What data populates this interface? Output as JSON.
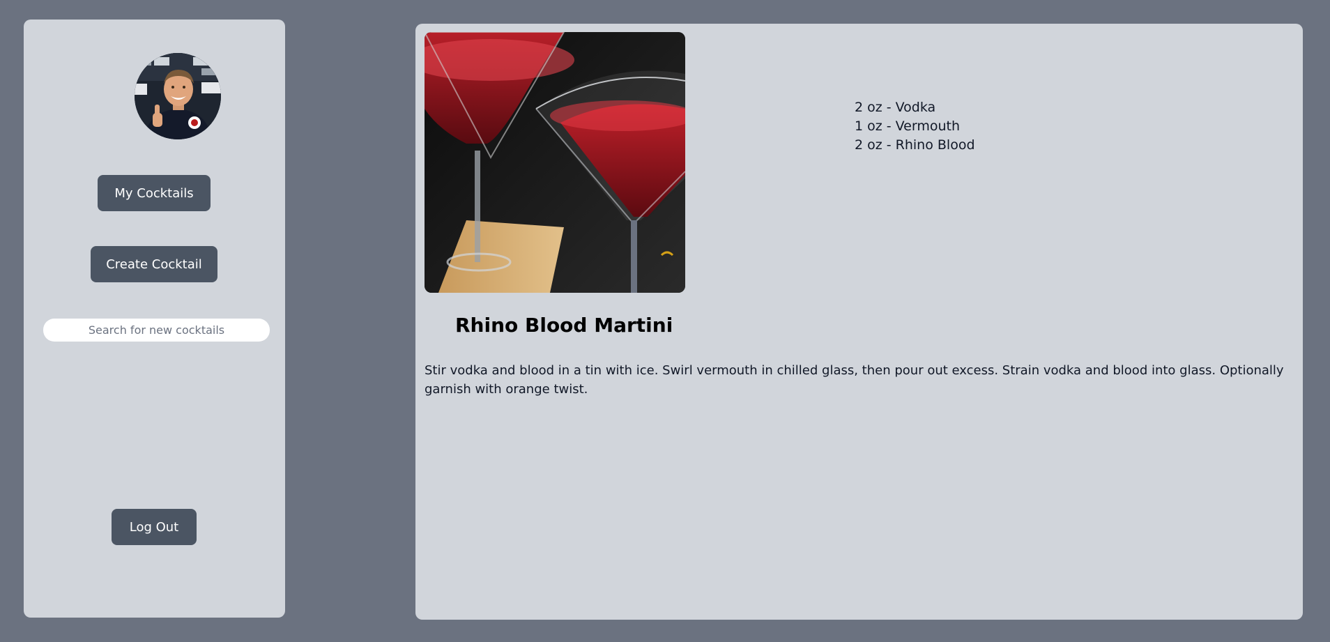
{
  "sidebar": {
    "avatar_alt": "User avatar",
    "my_cocktails_label": "My Cocktails",
    "create_cocktail_label": "Create Cocktail",
    "search_placeholder": "Search for new cocktails",
    "search_value": "",
    "logout_label": "Log Out"
  },
  "cocktail": {
    "name": "Rhino Blood Martini",
    "image_alt": "Two martini glasses with red cocktail",
    "ingredients": [
      "2 oz - Vodka",
      "1 oz - Vermouth",
      "2 oz - Rhino Blood"
    ],
    "instructions": "Stir vodka and blood in a tin with ice. Swirl vermouth in chilled glass, then pour out excess. Strain vodka and blood into glass. Optionally garnish with orange twist."
  },
  "colors": {
    "page_background": "#6b7280",
    "panel_background": "#d1d5db",
    "button_background": "#4b5563",
    "button_text": "#ffffff"
  }
}
